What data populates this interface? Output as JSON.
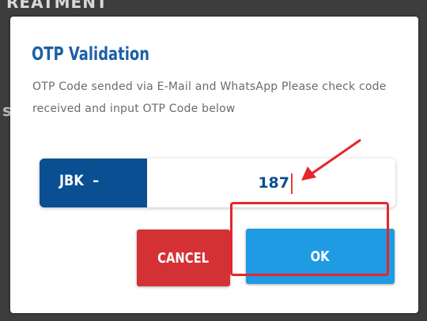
{
  "background": {
    "heading": "REATMENT",
    "side_glyph": "s"
  },
  "dialog": {
    "title": "OTP Validation",
    "description": "OTP Code sended via E-Mail and WhatsApp Please check code received and input OTP Code below",
    "otp": {
      "prefix": "JBK  –",
      "value": "187"
    },
    "buttons": {
      "cancel": "CANCEL",
      "ok": "OK"
    }
  },
  "colors": {
    "title": "#1d5fa6",
    "prefix_bg": "#0a4f91",
    "cancel_bg": "#d43135",
    "ok_bg": "#1e9be3",
    "annotation_red": "#e5262a"
  },
  "annotations": [
    {
      "type": "arrow",
      "color": "#e5262a",
      "points_to": "otp-input"
    },
    {
      "type": "highlight-box",
      "color": "#e5262a",
      "surrounds": "ok-button"
    }
  ]
}
